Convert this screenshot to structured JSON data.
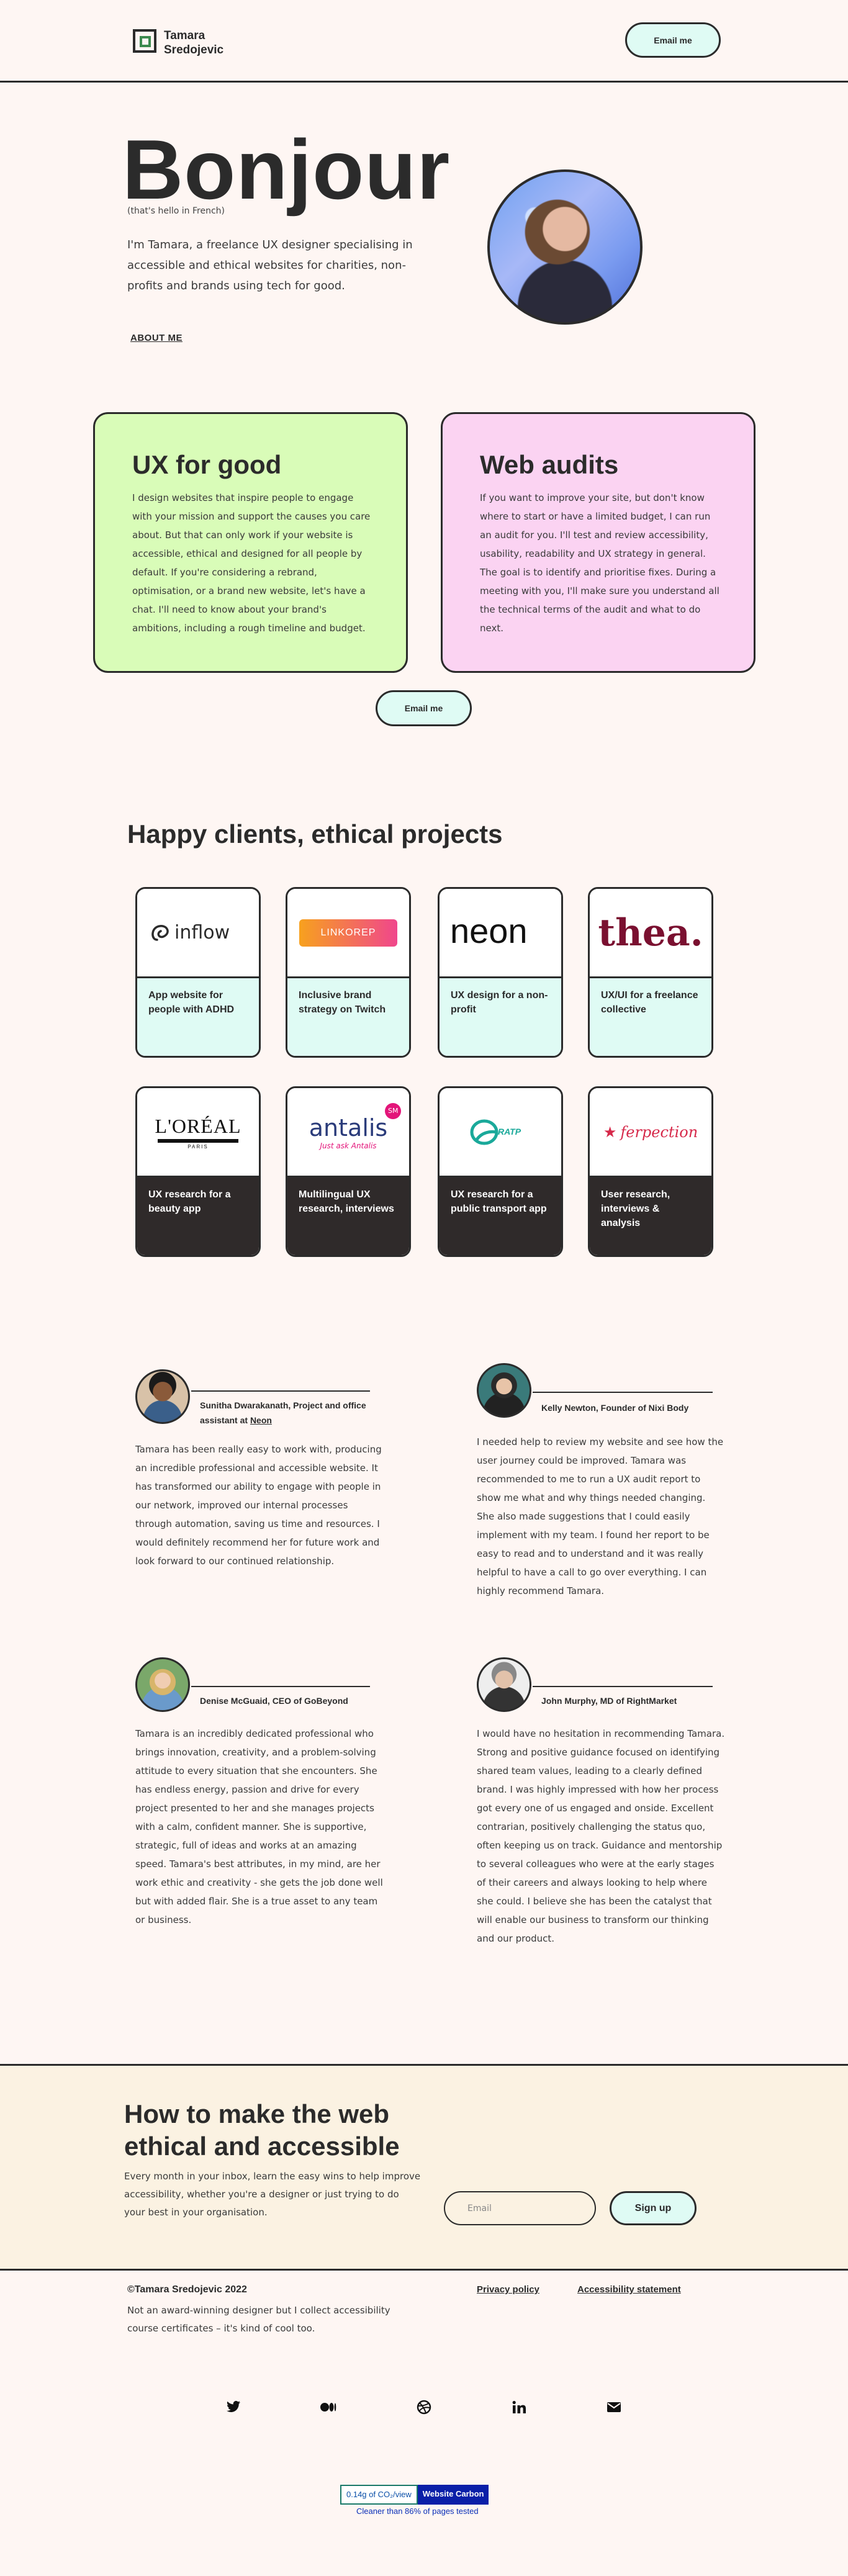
{
  "header": {
    "logo_line1": "Tamara",
    "logo_line2": "Sredojevic",
    "email_button": "Email me"
  },
  "hero": {
    "title": "Bonjour",
    "subtitle": "(that's hello in French)",
    "intro": "I'm Tamara, a freelance UX designer specialising in accessible and ethical websites for charities, non-profits and brands using tech for good.",
    "about_link": "ABOUT ME"
  },
  "services": [
    {
      "title": "UX for good",
      "body": "I design websites that inspire people to engage with your mission and support the causes you care about. But that can only work if your website is accessible, ethical and designed for all people by default. If you're considering a rebrand, optimisation, or a brand new website, let's have a chat. I'll need to know about your brand's ambitions, including a rough timeline and budget."
    },
    {
      "title": "Web audits",
      "body": "If you want to improve your site, but don't know where to start or have a limited budget, I can run an audit for you. I'll test and review accessibility, usability, readability and UX strategy in general. The goal is to identify and prioritise fixes. During a meeting with you, I'll make sure you understand all the technical terms of the audit and what to do next."
    }
  ],
  "mid_email_button": "Email me",
  "projects": {
    "title": "Happy clients, ethical projects",
    "items": [
      {
        "logo": "inflow",
        "caption": "App website for people with ADHD"
      },
      {
        "logo": "LINKOREP",
        "caption": "Inclusive brand strategy on Twitch"
      },
      {
        "logo": "neon",
        "caption": "UX design for a non-profit"
      },
      {
        "logo": "thea.",
        "caption": "UX/UI for a freelance collective"
      },
      {
        "logo": "L'ORÉAL",
        "logo_sub": "PARIS",
        "caption": "UX research for a beauty app"
      },
      {
        "logo": "antalis",
        "logo_badge": "SM",
        "logo_sub": "Just ask Antalis",
        "caption": "Multilingual UX research, interviews"
      },
      {
        "logo": "RATP",
        "caption": "UX research for a public transport app"
      },
      {
        "logo": "ferpection",
        "caption": "User research, interviews & analysis"
      }
    ]
  },
  "testimonials": [
    {
      "name": "Sunitha Dwarakanath, Project and office assistant at",
      "org_link": "Neon",
      "body": "Tamara has been really easy to work with, producing an incredible professional and accessible website. It has transformed our ability to engage with people in our network, improved our internal processes through automation, saving us time and resources. I would definitely recommend her for future work and look forward to our continued relationship."
    },
    {
      "name": "Kelly Newton, Founder of Nixi Body",
      "body": "I needed help to review my website and see how the user journey could be improved. Tamara was recommended to me to run a UX audit report to show me what and why things needed changing. She also made suggestions that I could easily implement with my team. I found her report to be easy to read and to understand and it was really helpful to have a call to go over everything. I can highly recommend Tamara."
    },
    {
      "name": "Denise McGuaid, CEO of GoBeyond",
      "body": "Tamara is an incredibly dedicated professional who brings innovation, creativity, and a problem-solving attitude to every situation that she encounters. She has endless energy, passion and drive for every project presented to her and she manages projects with a calm, confident manner. She is supportive, strategic, full of ideas and works at an amazing speed. Tamara's best attributes, in my mind, are her work ethic and creativity - she gets the job done well but with added flair. She is a true asset to any team or business."
    },
    {
      "name": "John Murphy, MD of RightMarket",
      "body": "I would have no hesitation in recommending Tamara. Strong and positive guidance focused on identifying shared team values, leading to a clearly defined brand. I was highly impressed with how her process got every one of us engaged and onside. Excellent contrarian, positively challenging the status quo, often keeping us on track. Guidance and mentorship to several colleagues who were at the early stages of their careers and always looking to help where she could. I believe she has been the catalyst that will enable our business to transform our thinking and our product."
    }
  ],
  "newsletter": {
    "title": "How to make the web ethical and accessible",
    "body": "Every month in your inbox, learn the easy wins to help improve accessibility, whether you're a designer or just trying to do your best in your organisation.",
    "email_placeholder": "Email",
    "signup_button": "Sign up"
  },
  "footer": {
    "copyright": "©Tamara Sredojevic 2022",
    "note": "Not an award-winning designer but I collect accessibility course certificates – it's kind of cool too.",
    "privacy_link": "Privacy policy",
    "accessibility_link": "Accessibility statement",
    "social_icons": [
      "twitter-icon",
      "medium-icon",
      "dribbble-icon",
      "linkedin-icon",
      "mail-icon"
    ]
  },
  "carbon": {
    "left": "0.14g of CO₂/view",
    "right": "Website Carbon",
    "sub": "Cleaner than 86% of pages tested"
  }
}
